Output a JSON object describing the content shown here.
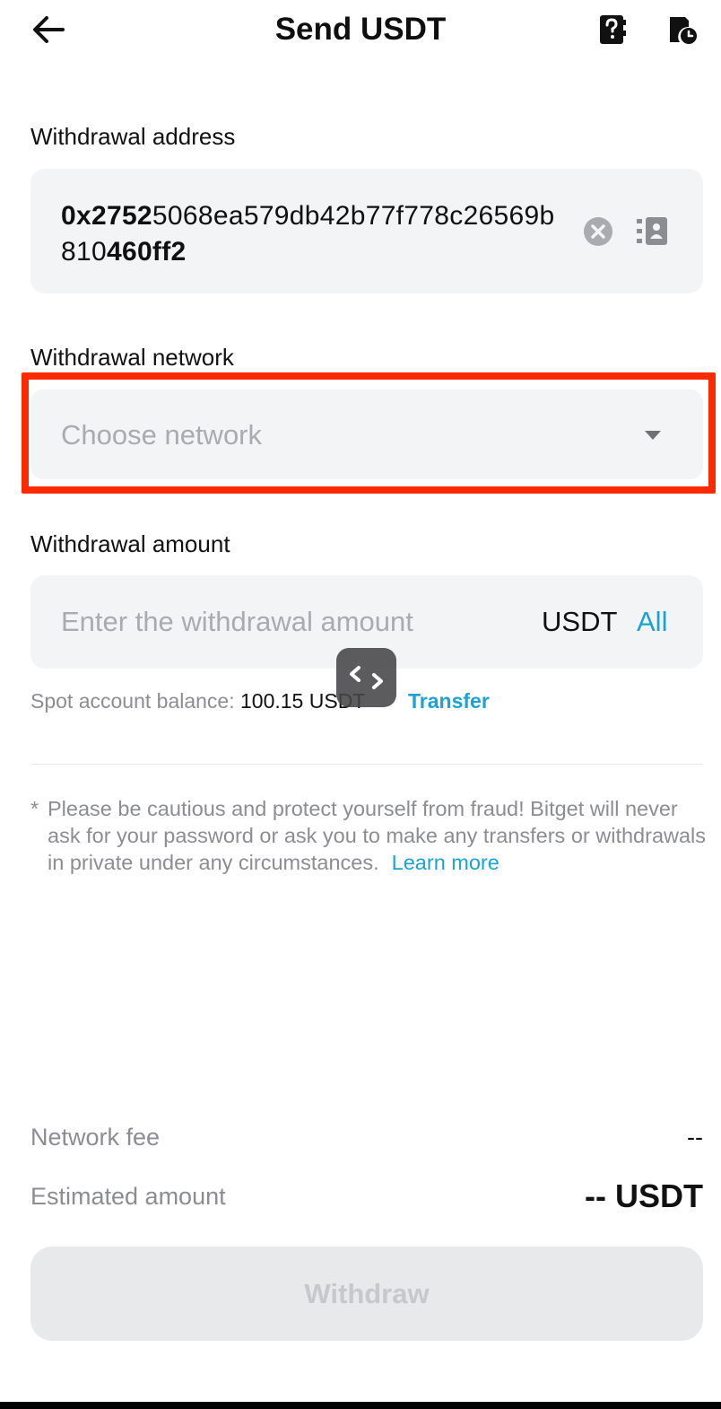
{
  "header": {
    "title": "Send USDT"
  },
  "address": {
    "label": "Withdrawal address",
    "value_line1_bold_start": "0x2752",
    "value_line1_rest": "5068ea579db42b77f778c265",
    "value_line2_start": "69b810",
    "value_line2_bold_end": "460ff2"
  },
  "network": {
    "label": "Withdrawal network",
    "placeholder": "Choose network"
  },
  "amount": {
    "label": "Withdrawal amount",
    "placeholder": "Enter the withdrawal amount",
    "unit": "USDT",
    "all_label": "All"
  },
  "balance": {
    "label": "Spot account balance: ",
    "value": "100.15 USDT",
    "transfer_label": "Transfer"
  },
  "warning": {
    "star": "*",
    "text": "Please be cautious and protect yourself from fraud! Bitget will never ask for your password or ask you to make any transfers or withdrawals in private under any circumstances.",
    "learn_more": "Learn more"
  },
  "summary": {
    "fee_label": "Network fee",
    "fee_value": "--",
    "estimated_label": "Estimated amount",
    "estimated_value": "-- USDT"
  },
  "button": {
    "withdraw_label": "Withdraw"
  },
  "colors": {
    "accent": "#1aa3d6",
    "highlight": "#fd2a00",
    "field_bg": "#f3f4f6",
    "muted_text": "#8b8d92"
  },
  "icons": {
    "back": "arrow-left-icon",
    "faq": "help-book-icon",
    "history": "history-icon",
    "clear": "clear-icon",
    "contacts": "address-book-icon",
    "dropdown": "caret-down-icon",
    "float": "code-brackets-icon"
  }
}
